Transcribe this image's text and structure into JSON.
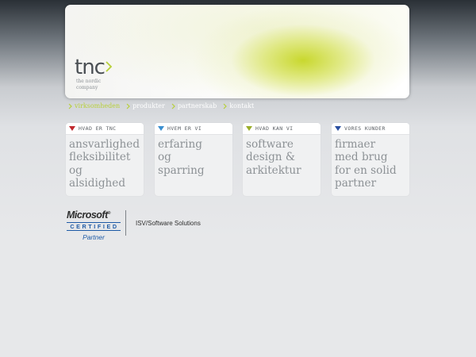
{
  "brand": {
    "name": "tnc",
    "tagline_line1": "the nordic",
    "tagline_line2": "company",
    "arrow_color": "#b8d03a"
  },
  "nav": {
    "items": [
      {
        "label": "virksomheden",
        "active": true
      },
      {
        "label": "produkter",
        "active": false
      },
      {
        "label": "partnerskab",
        "active": false
      },
      {
        "label": "kontakt",
        "active": false
      }
    ],
    "chevron_color": "#b8d03a"
  },
  "boxes": [
    {
      "title": "hvad er tnc",
      "body": "ansvarlighed\nfleksibilitet\nog\nalsidighed",
      "icon_color": "#c0282d"
    },
    {
      "title": "hvem er vi",
      "body": "erfaring\nog\nsparring",
      "icon_color": "#3a8fd0"
    },
    {
      "title": "hvad kan vi",
      "body": "software\ndesign &\narkitektur",
      "icon_color": "#9aae2a"
    },
    {
      "title": "vores kunder",
      "body": "firmaer\nmed brug\nfor en solid\npartner",
      "icon_color": "#2a4fa0"
    }
  ],
  "microsoft": {
    "word": "Microsoft",
    "certified": "CERTIFIED",
    "partner": "Partner",
    "solution": "ISV/Software Solutions"
  }
}
